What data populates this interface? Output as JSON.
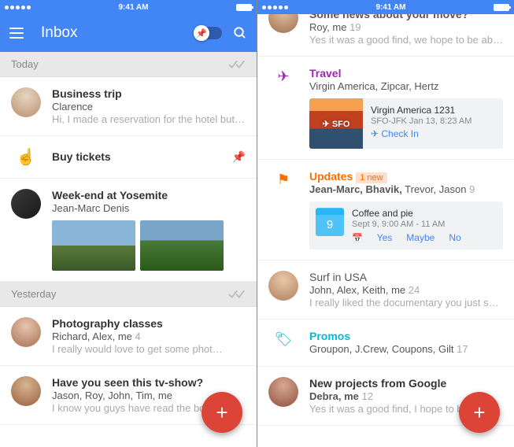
{
  "status": {
    "time": "9:41 AM"
  },
  "app": {
    "title": "Inbox"
  },
  "sections": {
    "today": "Today",
    "yesterday": "Yesterday"
  },
  "s1": {
    "items": [
      {
        "title": "Business trip",
        "sender": "Clarence",
        "preview": "Hi, I made a reservation for the hotel but it…"
      },
      {
        "task": "Buy tickets"
      },
      {
        "title": "Week-end at Yosemite",
        "sender": "Jean-Marc Denis"
      },
      {
        "title": "Photography classes",
        "sender": "Richard, Alex, me",
        "count": "4",
        "preview": "I really would love to get some phot…"
      },
      {
        "title": "Have you seen this tv-show?",
        "sender": "Jason, Roy, John, Tim, me",
        "preview": "I know you guys have read the book an"
      }
    ]
  },
  "s2": {
    "partial": {
      "title": "Some news about your move?",
      "sender": "Roy, me",
      "count": "19",
      "preview": "Yes it was a good find, we hope to be able …"
    },
    "travel": {
      "label": "Travel",
      "sender": "Virgin America, Zipcar, Hertz",
      "flight_title": "Virgin America 1231",
      "flight_sub": "SFO-JFK Jan 13, 8:23 AM",
      "checkin": "Check In",
      "airport": "SFO"
    },
    "updates": {
      "label": "Updates",
      "badge": "1 new",
      "sender": "Jean-Marc, Bhavik,",
      "sender2": " Trevor, Jason",
      "count": "9",
      "event_title": "Coffee and pie",
      "event_time": "Sept 9, 9:00 AM - 11 AM",
      "day": "9",
      "yes": "Yes",
      "maybe": "Maybe",
      "no": "No"
    },
    "surf": {
      "title": "Surf in USA",
      "sender": "John, Alex, Keith, me",
      "count": "24",
      "preview": "I really liked the documentary you just sent…"
    },
    "promos": {
      "label": "Promos",
      "sender": "Groupon, J.Crew, Coupons, Gilt",
      "count": "17"
    },
    "goog": {
      "title": "New projects from Google",
      "sender": "Debra, me",
      "count": "12",
      "preview": "Yes it was a good find, I hope to be able"
    }
  }
}
